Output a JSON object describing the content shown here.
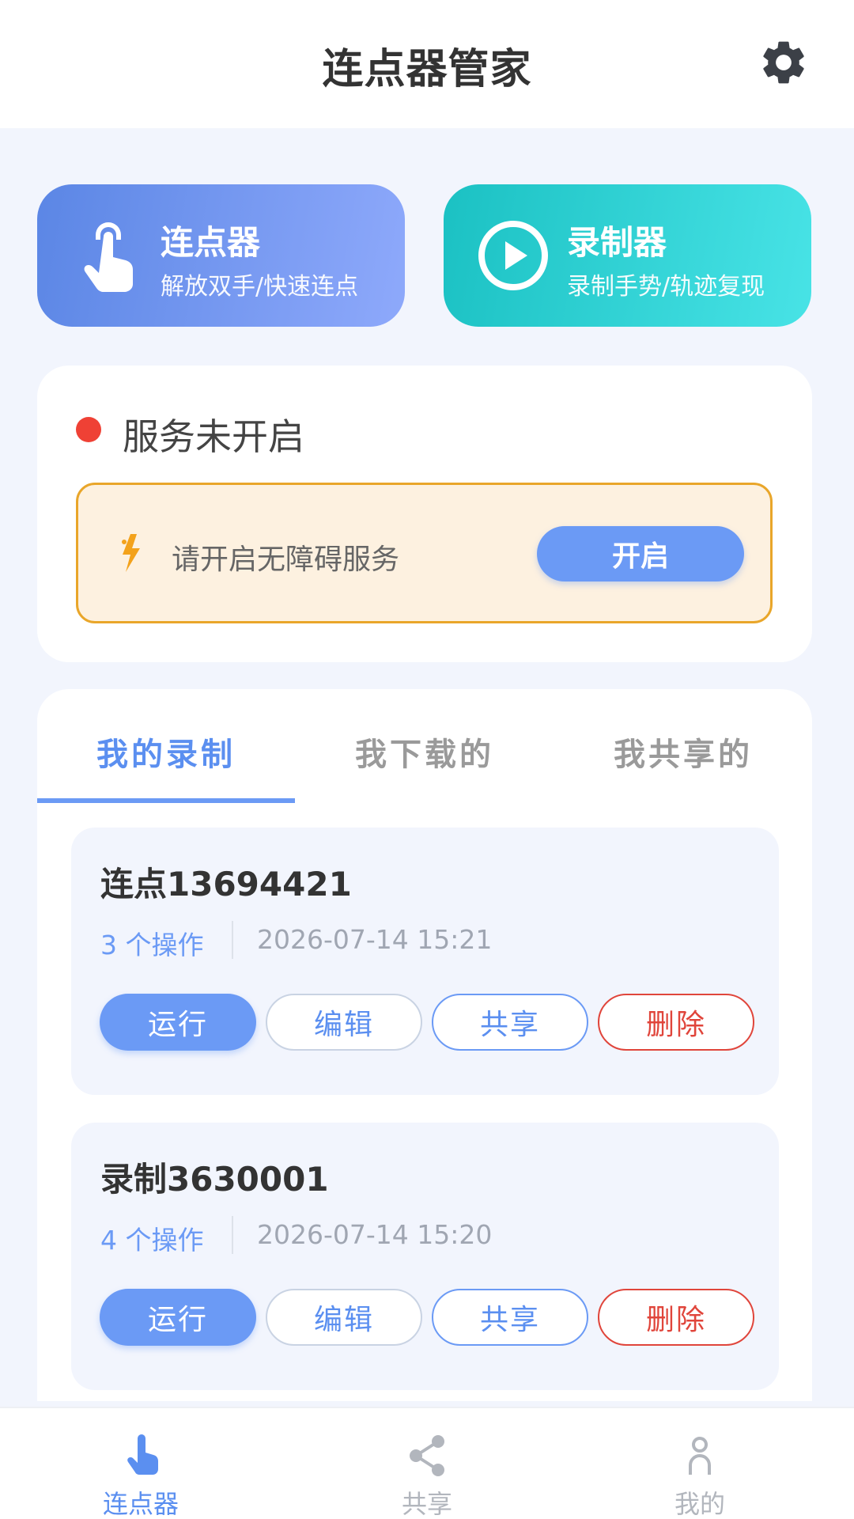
{
  "header": {
    "title": "连点器管家",
    "settings_icon": "gear-icon"
  },
  "features": [
    {
      "title": "连点器",
      "subtitle": "解放双手/快速连点",
      "icon": "tap-hand-icon"
    },
    {
      "title": "录制器",
      "subtitle": "录制手势/轨迹复现",
      "icon": "play-circle-icon"
    }
  ],
  "service": {
    "status_text": "服务未开启",
    "status_color": "#ef4135",
    "alert_text": "请开启无障碍服务",
    "enable_label": "开启"
  },
  "tabs": [
    {
      "label": "我的录制",
      "active": true
    },
    {
      "label": "我下载的",
      "active": false
    },
    {
      "label": "我共享的",
      "active": false
    }
  ],
  "recordings": [
    {
      "title": "连点13694421",
      "ops": "3 个操作",
      "time": "2026-07-14 15:21"
    },
    {
      "title": "录制3630001",
      "ops": "4 个操作",
      "time": "2026-07-14 15:20"
    }
  ],
  "actions": {
    "run": "运行",
    "edit": "编辑",
    "share": "共享",
    "delete": "删除"
  },
  "nav": [
    {
      "label": "连点器",
      "icon": "tap-hand-icon",
      "active": true
    },
    {
      "label": "共享",
      "icon": "share-icon",
      "active": false
    },
    {
      "label": "我的",
      "icon": "person-icon",
      "active": false
    }
  ],
  "colors": {
    "accent": "#6b9af5",
    "danger": "#e0453b",
    "teal": "#1bc1c3"
  }
}
